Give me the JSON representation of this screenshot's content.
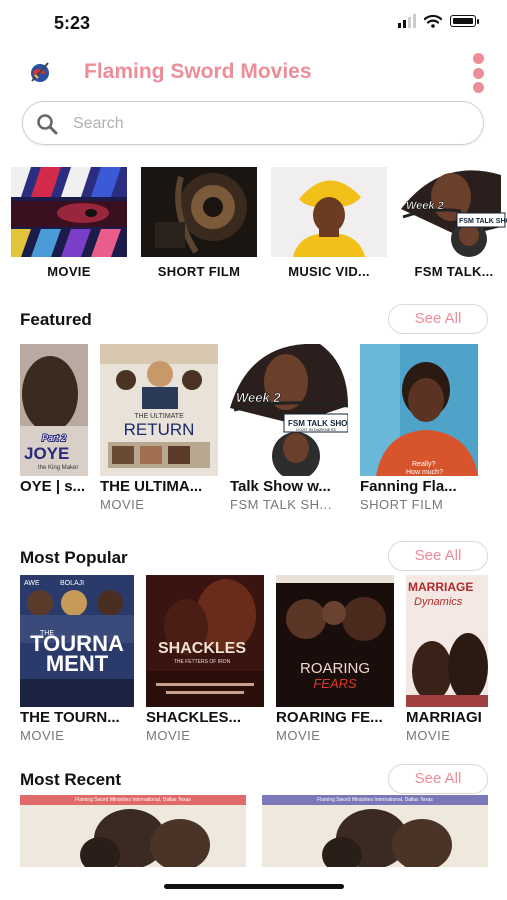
{
  "status": {
    "time": "5:23"
  },
  "app": {
    "title": "Flaming Sword Movies"
  },
  "search": {
    "placeholder": "Search"
  },
  "categories": [
    {
      "label": "MOVIE"
    },
    {
      "label": "SHORT FILM"
    },
    {
      "label": "MUSIC VID..."
    },
    {
      "label": "FSM TALK..."
    }
  ],
  "sections": {
    "featured": {
      "title": "Featured",
      "see_all": "See All",
      "items": [
        {
          "title": "OYE | s...",
          "subtitle": ""
        },
        {
          "title": "THE ULTIMA...",
          "subtitle": "MOVIE"
        },
        {
          "title": "Talk Show w...",
          "subtitle": "FSM TALK SH..."
        },
        {
          "title": "Fanning Fla...",
          "subtitle": "SHORT FILM"
        }
      ]
    },
    "popular": {
      "title": "Most Popular",
      "see_all": "See All",
      "items": [
        {
          "title": "THE TOURN...",
          "subtitle": "MOVIE"
        },
        {
          "title": "SHACKLES...",
          "subtitle": "MOVIE"
        },
        {
          "title": "ROARING FE...",
          "subtitle": "MOVIE"
        },
        {
          "title": "MARRIAGI",
          "subtitle": "MOVIE"
        }
      ]
    },
    "recent": {
      "title": "Most Recent",
      "see_all": "See All",
      "items": [
        {
          "banner": "Flaming Sword Ministries International, Dallas Texas"
        },
        {
          "banner": "Flaming Sword Ministries International, Dallas Texas"
        }
      ]
    }
  },
  "poster_text": {
    "joye_part": "Part 2",
    "joye_title": "JOYE",
    "joye_tag": "the King Maker",
    "return_top": "THE ULTIMATE",
    "return_title": "RETURN",
    "week2": "Week 2",
    "fsm_talk": "FSM TALK SHOW",
    "fsm_talk_sub": "LIGHT IN DARKNESS",
    "really": "Really?",
    "how_much": "How much?",
    "tourna_1": "TOURNA",
    "tourna_2": "MENT",
    "tourna_the": "THE",
    "awe": "AWE",
    "bolaji": "BOLAJI",
    "shackles": "SHACKLES",
    "shackles_sub": "THE FETTERS OF IRON",
    "roaring_1": "ROARING",
    "roaring_2": "FEARS",
    "marriage_1": "MARRIAGE",
    "marriage_2": "Dynamics"
  },
  "colors": {
    "accent": "#ec8d99",
    "text": "#111111",
    "subtext": "#777777",
    "recent_bar_1": "#e06a6a",
    "recent_bar_2": "#7a78b8"
  },
  "icons": {
    "logo": "flaming-sword-logo",
    "menu": "vertical-dots-icon",
    "search": "magnifier-icon"
  }
}
